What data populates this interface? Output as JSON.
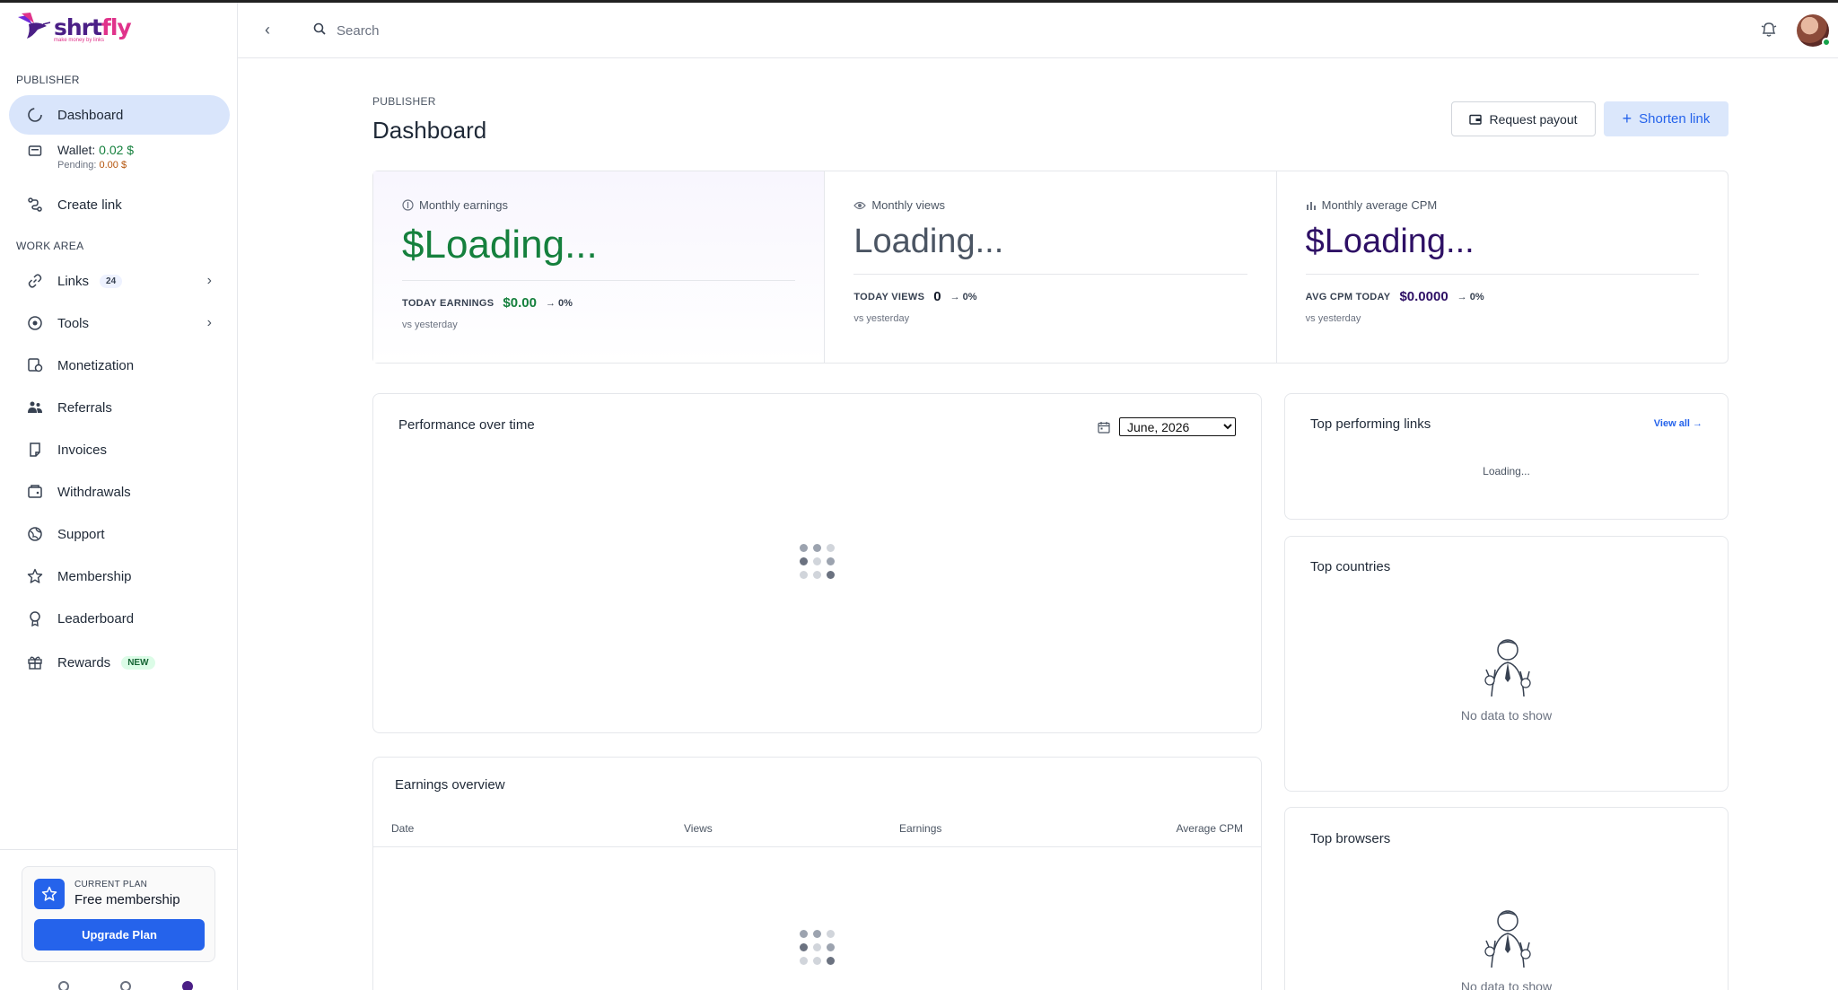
{
  "brand": {
    "name_main": "shrt",
    "name_accent": "fly",
    "tagline": "make money by links"
  },
  "sidebar": {
    "section_publisher": "PUBLISHER",
    "section_work": "WORK AREA",
    "dashboard": "Dashboard",
    "wallet_label": "Wallet:",
    "wallet_value": "0.02 $",
    "pending_label": "Pending:",
    "pending_value": "0.00 $",
    "create_link": "Create link",
    "links": "Links",
    "links_count": "24",
    "tools": "Tools",
    "monetization": "Monetization",
    "referrals": "Referrals",
    "invoices": "Invoices",
    "withdrawals": "Withdrawals",
    "support": "Support",
    "membership": "Membership",
    "leaderboard": "Leaderboard",
    "rewards": "Rewards",
    "rewards_badge": "NEW",
    "plan_kicker": "CURRENT PLAN",
    "plan_name": "Free membership",
    "upgrade": "Upgrade Plan"
  },
  "topbar": {
    "search_placeholder": "Search"
  },
  "header": {
    "kicker": "PUBLISHER",
    "title": "Dashboard",
    "request_payout": "Request payout",
    "shorten_link": "Shorten link"
  },
  "stats": {
    "earnings": {
      "label": "Monthly earnings",
      "value": "$Loading...",
      "today_label": "TODAY EARNINGS",
      "today_value": "$0.00",
      "delta": "→ 0%",
      "vs": "vs yesterday"
    },
    "views": {
      "label": "Monthly views",
      "value": "Loading...",
      "today_label": "TODAY VIEWS",
      "today_value": "0",
      "delta": "→ 0%",
      "vs": "vs yesterday"
    },
    "cpm": {
      "label": "Monthly average CPM",
      "value": "$Loading...",
      "today_label": "AVG CPM TODAY",
      "today_value": "$0.0000",
      "delta": "→ 0%",
      "vs": "vs yesterday"
    }
  },
  "performance": {
    "title": "Performance over time",
    "month_selected": "June, 2026"
  },
  "top_links": {
    "title": "Top performing links",
    "view_all": "View all →",
    "loading": "Loading..."
  },
  "countries": {
    "title": "Top countries",
    "empty": "No data to show"
  },
  "browsers": {
    "title": "Top browsers",
    "empty": "No data to show"
  },
  "earnings_overview": {
    "title": "Earnings overview",
    "columns": [
      "Date",
      "Views",
      "Earnings",
      "Average CPM"
    ]
  },
  "colors": {
    "accent": "#2563eb",
    "active_nav": "#d9e5fb",
    "earnings_green": "#15803d",
    "cpm_purple": "#2e1065"
  }
}
